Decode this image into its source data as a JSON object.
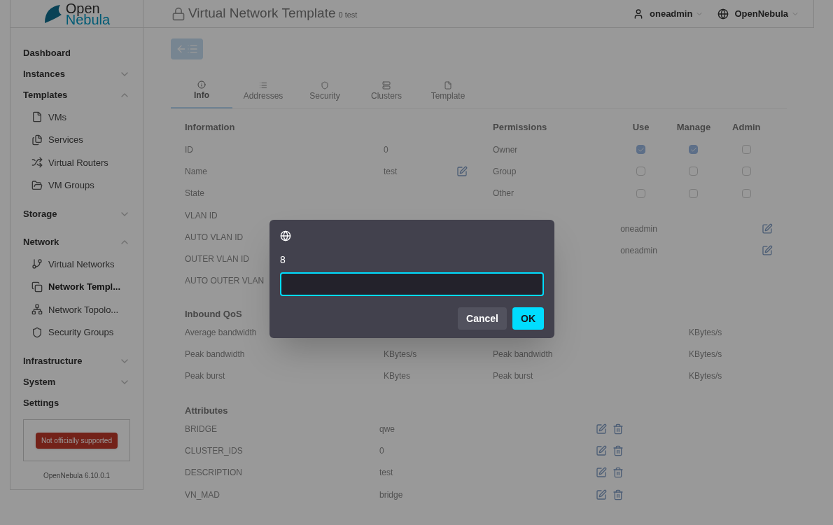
{
  "header": {
    "title": "Virtual Network Template",
    "subtitle": "0 test",
    "user": "oneadmin",
    "zone": "OpenNebula"
  },
  "logo": {
    "line1": "Open",
    "line2": "Nebula"
  },
  "sidebar": {
    "items": [
      {
        "label": "Dashboard"
      },
      {
        "label": "Instances",
        "expandable": true,
        "expanded": false
      },
      {
        "label": "Templates",
        "expandable": true,
        "expanded": true,
        "children": [
          {
            "label": "VMs",
            "selected": false
          },
          {
            "label": "Services",
            "selected": false
          },
          {
            "label": "Virtual Routers",
            "selected": false
          },
          {
            "label": "VM Groups",
            "selected": false
          }
        ]
      },
      {
        "label": "Storage",
        "expandable": true,
        "expanded": false
      },
      {
        "label": "Network",
        "expandable": true,
        "expanded": true,
        "children": [
          {
            "label": "Virtual Networks",
            "selected": false
          },
          {
            "label": "Network Templ...",
            "selected": true
          },
          {
            "label": "Network Topolo...",
            "selected": false
          },
          {
            "label": "Security Groups",
            "selected": false
          }
        ]
      },
      {
        "label": "Infrastructure",
        "expandable": true,
        "expanded": false
      },
      {
        "label": "System",
        "expandable": true,
        "expanded": false
      },
      {
        "label": "Settings"
      }
    ],
    "badge": "Not officially supported",
    "version": "OpenNebula 6.10.0.1"
  },
  "tabs": [
    {
      "label": "Info",
      "selected": true
    },
    {
      "label": "Addresses",
      "selected": false
    },
    {
      "label": "Security",
      "selected": false
    },
    {
      "label": "Clusters",
      "selected": false
    },
    {
      "label": "Template",
      "selected": false
    }
  ],
  "information": {
    "title": "Information",
    "rows": [
      {
        "label": "ID",
        "value": "0",
        "editable": false
      },
      {
        "label": "Name",
        "value": "test",
        "editable": true
      },
      {
        "label": "State",
        "editable": false
      },
      {
        "label": "VLAN ID",
        "editable": false
      },
      {
        "label": "AUTO VLAN ID"
      },
      {
        "label": "OUTER VLAN ID"
      },
      {
        "label": "AUTO OUTER VLAN"
      }
    ]
  },
  "permissions": {
    "title": "Permissions",
    "columns": [
      "Use",
      "Manage",
      "Admin"
    ],
    "rows": [
      {
        "label": "Owner",
        "checks": [
          true,
          true,
          false
        ]
      },
      {
        "label": "Group",
        "checks": [
          false,
          false,
          false
        ]
      },
      {
        "label": "Other",
        "checks": [
          false,
          false,
          false
        ]
      }
    ]
  },
  "ownership": {
    "rows": [
      {
        "value": "oneadmin"
      },
      {
        "value": "oneadmin"
      }
    ]
  },
  "qos": {
    "title": "Inbound QoS",
    "rows": [
      {
        "label": "Average bandwidth",
        "right_value": "KBytes/s"
      },
      {
        "label": "Peak bandwidth",
        "value": "KBytes/s",
        "right_label": "Peak bandwidth",
        "right_value": "KBytes/s"
      },
      {
        "label": "Peak burst",
        "value": "KBytes",
        "right_label": "Peak burst",
        "right_value": "KBytes/s"
      }
    ]
  },
  "attributes": {
    "title": "Attributes",
    "rows": [
      {
        "name": "BRIDGE",
        "value": "qwe"
      },
      {
        "name": "CLUSTER_IDS",
        "value": "0"
      },
      {
        "name": "DESCRIPTION",
        "value": "test"
      },
      {
        "name": "VN_MAD",
        "value": "bridge"
      }
    ]
  },
  "dialog": {
    "message": "8",
    "buttons": [
      {
        "label": "Cancel",
        "kind": "secondary"
      },
      {
        "label": "OK",
        "kind": "primary"
      }
    ]
  }
}
